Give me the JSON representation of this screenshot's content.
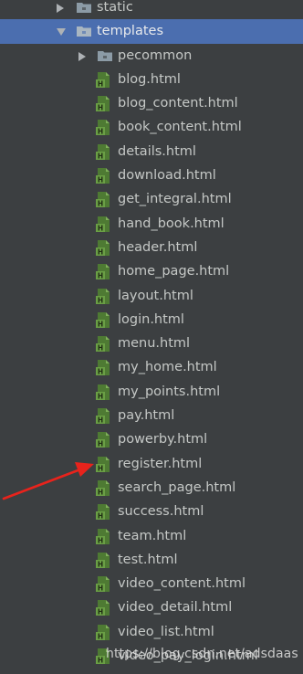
{
  "tree": {
    "static_label": "static",
    "templates_label": "templates",
    "pecommon_label": "pecommon",
    "files": [
      "blog.html",
      "blog_content.html",
      "book_content.html",
      "details.html",
      "download.html",
      "get_integral.html",
      "hand_book.html",
      "header.html",
      "home_page.html",
      "layout.html",
      "login.html",
      "menu.html",
      "my_home.html",
      "my_points.html",
      "pay.html",
      "powerby.html",
      "register.html",
      "search_page.html",
      "success.html",
      "team.html",
      "test.html",
      "video_content.html",
      "video_detail.html",
      "video_list.html",
      "video_pay_login.html"
    ],
    "highlighted_file": "register.html"
  },
  "watermark": "https://blog.csdn.net/adsdaas",
  "colors": {
    "background": "#3c3f41",
    "selection": "#4b6eaf",
    "html_icon": "#5a8a3a",
    "annotation_arrow": "#e8231c"
  },
  "icons": {
    "folder": "folder-icon",
    "html_file": "html-file-icon",
    "expand": "chevron-right-icon",
    "collapse": "chevron-down-icon"
  }
}
